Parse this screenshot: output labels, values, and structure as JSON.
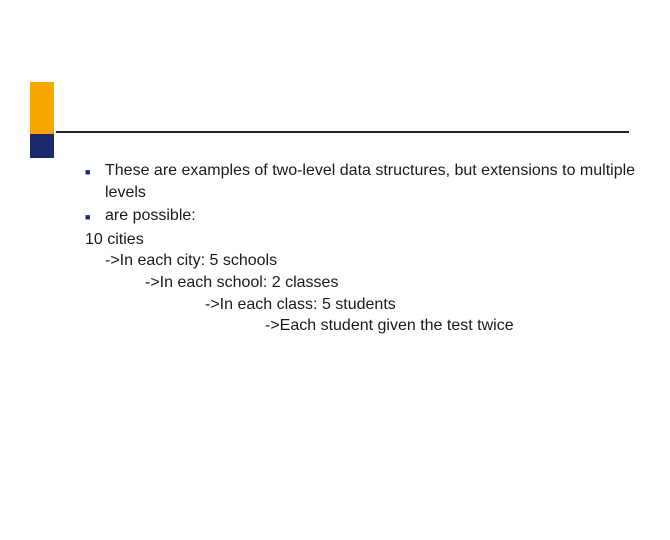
{
  "bullets": [
    {
      "text": "These are examples of two-level data structures, but extensions to multiple levels"
    },
    {
      "text": "are possible:"
    }
  ],
  "lines": {
    "root": "10 cities",
    "l1": "->In each city: 5 schools",
    "l2": "->In each school: 2 classes",
    "l3": "->In each class: 5 students",
    "l4": "->Each student given the test twice"
  }
}
